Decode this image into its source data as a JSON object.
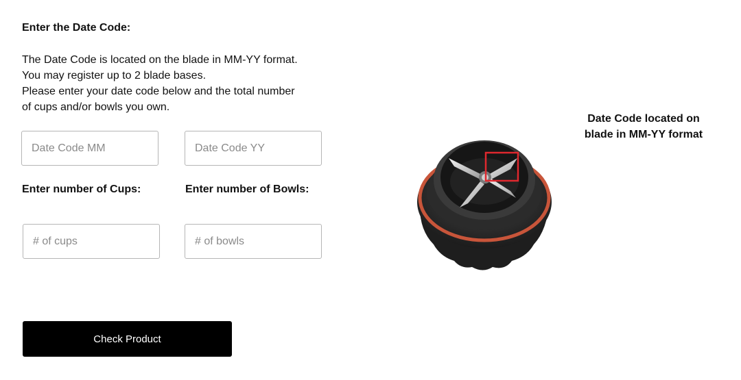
{
  "date_code": {
    "heading": "Enter the Date Code:",
    "description_lines": [
      "The Date Code is located on the blade in MM-YY format.",
      "You may register up to 2 blade bases.",
      "Please enter your date code below and the total number",
      "of cups and/or bowls you own."
    ],
    "mm_placeholder": "Date Code MM",
    "yy_placeholder": "Date Code YY"
  },
  "cups": {
    "label": "Enter number of Cups:",
    "placeholder": "# of cups"
  },
  "bowls": {
    "label": "Enter number of Bowls:",
    "placeholder": "# of bowls"
  },
  "submit": {
    "label": "Check Product"
  },
  "illustration": {
    "caption_lines": [
      "Date Code located on",
      "blade in MM-YY format"
    ],
    "highlight_color": "#e0282e",
    "gasket_color": "#c8553a"
  }
}
